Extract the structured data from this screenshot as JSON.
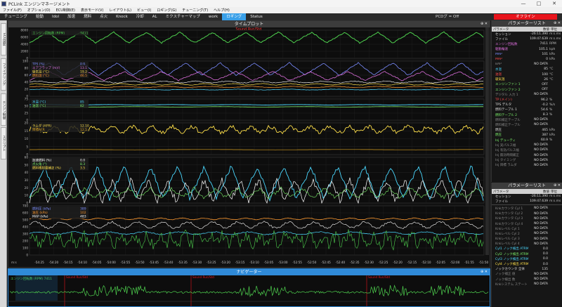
{
  "window": {
    "title": "PCLink エンジンマネージメント",
    "controls": [
      "—",
      "□",
      "✕"
    ]
  },
  "menu": [
    "ファイル(F)",
    "オプション(O)",
    "ECU制御(E)",
    "表示モード(V)",
    "レイアウト(L)",
    "ビュー(I)",
    "ロギング(G)",
    "チューニング(T)",
    "ヘルプ(H)"
  ],
  "tabs": [
    "チューニング",
    "始動",
    "Idol",
    "加速",
    "燃料",
    "点火",
    "Knock",
    "冷却",
    "AL",
    "ミクスチャーマップ",
    "work",
    "ロギング",
    "Status"
  ],
  "active_tab": "ロギング",
  "status": {
    "pcd": "PCDグ = Off",
    "online": "オフライン"
  },
  "left_rail": [
    "ECU設定",
    "ファイアリング",
    "エンジン制御",
    "スクリプト"
  ],
  "timeplot": {
    "title": "タイムプロット",
    "subtitle": "Sound Run/Std",
    "time_unit": "m:s",
    "x_ticks": [
      "-54:25",
      "-54:20",
      "-54:15",
      "-54:10",
      "-54:05",
      "-54:00",
      "-53:55",
      "-53:50",
      "-53:45",
      "-53:40",
      "-53:35",
      "-53:30",
      "-53:25",
      "-53:20",
      "-53:15",
      "-53:10",
      "-53:05",
      "-53:00",
      "-52:55",
      "-52:50",
      "-52:45",
      "-52:40",
      "-52:35",
      "-52:30",
      "-52:25",
      "-52:20",
      "-52:15",
      "-52:10",
      "-52:05",
      "-52:00",
      "-51:55",
      "-51:50"
    ],
    "panes": [
      {
        "label": "エンジン回転数 (RPM)",
        "value": "7411",
        "y_ticks": [
          "8000",
          "6000",
          "4000",
          "2000",
          "0"
        ]
      },
      {
        "label": "TPS (%)",
        "extra": [
          "エアフラップ (mV)",
          "吸気温 (°C)",
          "燃料温 (°C)"
        ],
        "values": [
          "0.0",
          "13.1",
          "19.2",
          "46.5"
        ],
        "y_ticks": [
          "100",
          "80",
          "60",
          "40",
          "20",
          "0"
        ]
      },
      {
        "label": "水温 (°C)",
        "extra": [
          "油温 (°C)"
        ],
        "values": [
          "85",
          "82"
        ],
        "y_ticks": [
          "75",
          "50",
          "25",
          "0"
        ]
      },
      {
        "label": "ラムダ (AFR)",
        "extra": [
          "目標AFR"
        ],
        "values": [
          "12.10",
          "12.5"
        ],
        "y_ticks": [
          "20",
          "15",
          "10",
          "5",
          "0"
        ]
      },
      {
        "label": "加速燃料 (%)",
        "extra": [
          "点火角 (°)",
          "燃料噴射量補正 (%)"
        ],
        "values": [
          "0.0",
          "8.3",
          "3.5"
        ],
        "y_ticks": [
          "60",
          "50",
          "40",
          "30",
          "20",
          "10",
          "0"
        ]
      },
      {
        "label": "燃料圧 (kPa)",
        "extra": [
          "油圧 (kPa)",
          "MAP (kPa)"
        ],
        "values": [
          "389",
          "102",
          "483"
        ],
        "y_ticks": [
          "700",
          "600",
          "500",
          "400",
          "300",
          "200",
          "100",
          "0"
        ]
      }
    ]
  },
  "navigator": {
    "title": "ナビゲーター",
    "label": "エンジン回転数 (RPM) 7411",
    "markers": [
      "Sound Run/Std",
      "Sound Run/Std",
      "Sound Run/Std"
    ]
  },
  "params1": {
    "title": "パラメーターリスト",
    "columns": [
      "パラメータ",
      "数値",
      "単位"
    ],
    "rows": [
      [
        "セッション",
        "-26:11.390",
        "m:s.ms",
        "#dddddd"
      ],
      [
        "ファイル",
        "109:47.639",
        "m:s.ms",
        "#dddddd"
      ],
      [
        "エンジン回転数",
        "7411",
        "RPM",
        "#d86cd8"
      ],
      [
        "駆動輪速",
        "105.1",
        "kph",
        "#d86cd8"
      ],
      [
        "MAP",
        "101",
        "kPa",
        "#7b8cff"
      ],
      [
        "MAP",
        "0",
        "kPa",
        "#ff4a4a"
      ],
      [
        "BAP",
        "NO DATA",
        "",
        "#888888"
      ],
      [
        "水温",
        "85",
        "°C",
        "#4ad8ff"
      ],
      [
        "油温",
        "100",
        "°C",
        "#ff4a4a"
      ],
      [
        "吸気温",
        "26",
        "°C",
        "#ffe04a"
      ],
      [
        "エンジンファン 1",
        "OFF",
        "",
        "#7cf06a"
      ],
      [
        "エンジンファン 2",
        "OFF",
        "",
        "#7cf06a"
      ],
      [
        "デジタル 入力 1",
        "NO DATA",
        "",
        "#888888"
      ],
      [
        "TP (メイン)",
        "96.2",
        "%",
        "#ff4a4a"
      ],
      [
        "TPS デルタ",
        "-0.2",
        "%/s",
        "#dddddd"
      ],
      [
        "燃料テーブル 1",
        "54.6",
        "%",
        "#dddddd"
      ],
      [
        "燃料テーブル 2",
        "8.3",
        "%",
        "#7cf06a"
      ],
      [
        "燃料補正テーブル",
        "NO DATA",
        "",
        "#888888"
      ],
      [
        "燃料補正テーブル",
        "NO DATA",
        "",
        "#888888"
      ],
      [
        "燃圧",
        "465",
        "kPa",
        "#dddddd"
      ],
      [
        "燃圧",
        "387",
        "kPa",
        "#7cf06a"
      ],
      [
        "Inj デューティ",
        "60.9",
        "%",
        "#7cf06a"
      ],
      [
        "Inj 実パルス幅",
        "NO DATA",
        "",
        "#888888"
      ],
      [
        "Inj 有効パルス幅",
        "NO DATA",
        "",
        "#888888"
      ],
      [
        "Inj 無効時間補正",
        "NO DATA",
        "",
        "#888888"
      ],
      [
        "Inj タイミング",
        "NO DATA",
        "",
        "#888888"
      ],
      [
        "Inj 目標 ラムダ",
        "NO DATA",
        "",
        "#888888"
      ]
    ]
  },
  "params2": {
    "title": "パラメーターリスト",
    "columns": [
      "パラメータ",
      "数値",
      "単位"
    ],
    "rows": [
      [
        "セッション",
        "-26:11.390",
        "m:s.ms",
        "#dddddd"
      ],
      [
        "ファイル",
        "109:47.639",
        "m:s.ms",
        "#dddddd"
      ],
      [
        "",
        "",
        "",
        "#888888"
      ],
      [
        "Knkカウンタ Cyl 1",
        "NO DATA",
        "",
        "#888888"
      ],
      [
        "Knkカウンタ Cyl 2",
        "NO DATA",
        "",
        "#888888"
      ],
      [
        "Knkカウンタ Cyl 3",
        "NO DATA",
        "",
        "#888888"
      ],
      [
        "Knkカウンタ Cyl 4",
        "NO DATA",
        "",
        "#888888"
      ],
      [
        "Knkレベル Cyl 1",
        "NO DATA",
        "",
        "#888888"
      ],
      [
        "Knkレベル Cyl 2",
        "NO DATA",
        "",
        "#888888"
      ],
      [
        "Knkレベル Cyl 3",
        "NO DATA",
        "",
        "#888888"
      ],
      [
        "Knkレベル Cyl 4",
        "NO DATA",
        "",
        "#888888"
      ],
      [
        "Cyl1 ノック検出 ATRM",
        "0.0",
        "",
        "#4ad8ff"
      ],
      [
        "Cyl2 ノック検出 ATRM",
        "0.0",
        "",
        "#7cf06a"
      ],
      [
        "Cyl3 ノック検出 ATRM",
        "0.0",
        "",
        "#4ad8ff"
      ],
      [
        "Cyl4 ノック検出 ATRM",
        "0.0",
        "",
        "#ffe04a"
      ],
      [
        "ノックカウンタ 全体",
        "135",
        "",
        "#dddddd"
      ],
      [
        "ノック補正 値",
        "NO DATA",
        "",
        "#888888"
      ],
      [
        "ノック検出 数",
        "NO DATA",
        "",
        "#888888"
      ],
      [
        "Knkシステム ステート",
        "NO DATA",
        "",
        "#888888"
      ]
    ]
  }
}
